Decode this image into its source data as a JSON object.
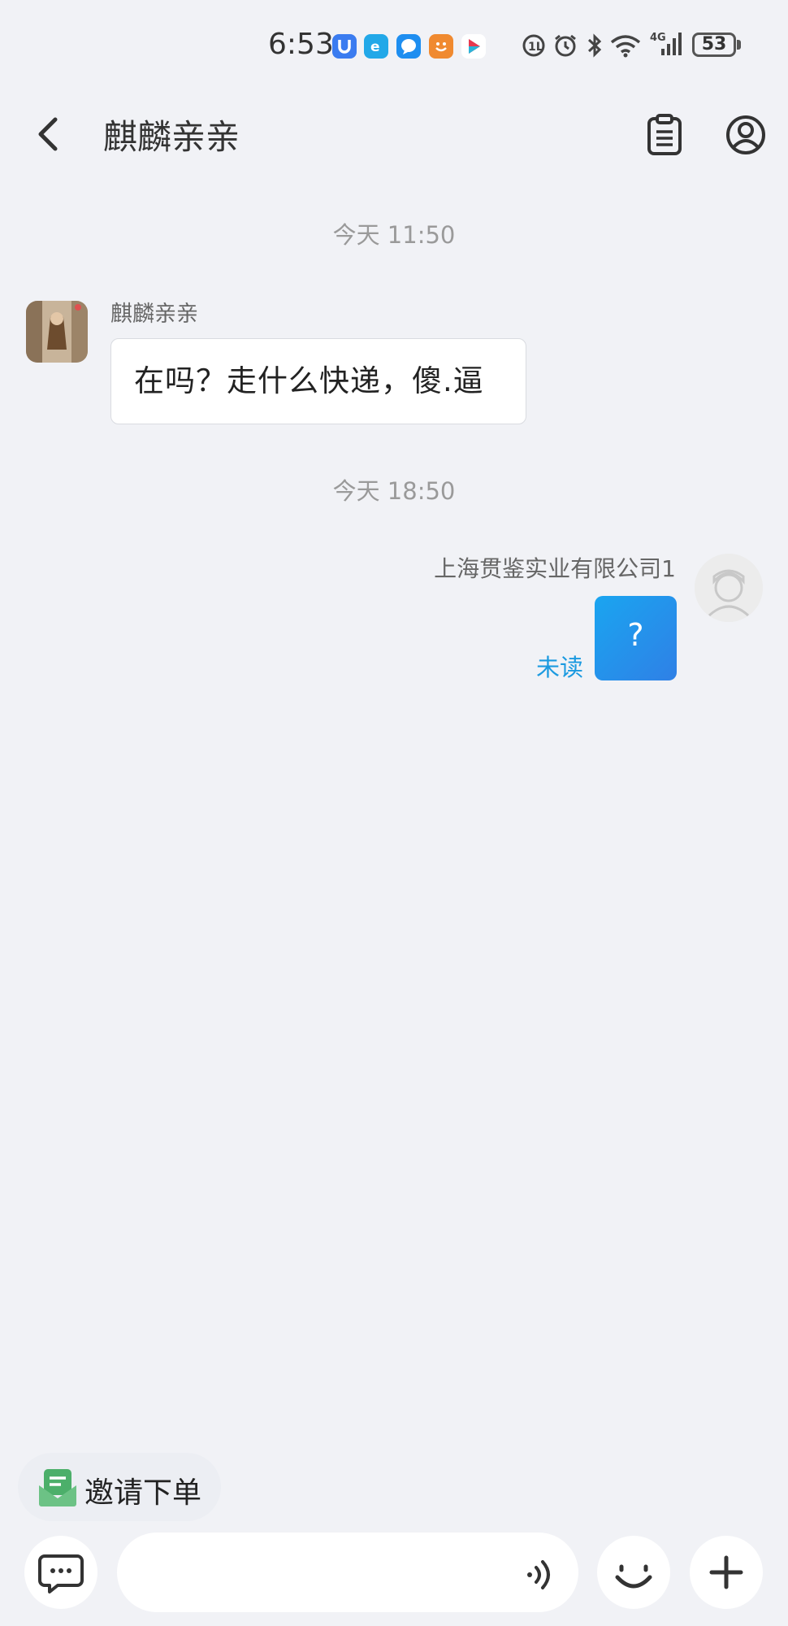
{
  "status_bar": {
    "time": "6:53",
    "battery": "53",
    "network": "4G",
    "notification_apps": [
      {
        "icon": "app-u-icon",
        "color": "#3b7cf0"
      },
      {
        "icon": "app-e-icon",
        "color": "#22a8e8"
      },
      {
        "icon": "app-chat-icon",
        "color": "#1e8ef0"
      },
      {
        "icon": "app-smile-icon",
        "color": "#f08a30"
      },
      {
        "icon": "app-play-icon",
        "color": "#e8384f"
      }
    ]
  },
  "header": {
    "title": "麒麟亲亲",
    "back_icon": "chevron-left-icon",
    "order_icon": "clipboard-icon",
    "profile_icon": "user-circle-icon"
  },
  "messages": [
    {
      "type": "time",
      "text": "今天  11:50"
    },
    {
      "type": "incoming",
      "sender": "麒麟亲亲",
      "text": "在吗？走什么快递，傻.逼"
    },
    {
      "type": "time",
      "text": "今天  18:50"
    },
    {
      "type": "outgoing",
      "sender": "上海贯鉴实业有限公司1",
      "text": "?",
      "status": "未读"
    }
  ],
  "invite": {
    "label": "邀请下单",
    "icon": "invite-envelope-icon",
    "color": "#4caf6a"
  },
  "input_bar": {
    "placeholder": "",
    "chat_icon": "chat-bubble-icon",
    "voice_icon": "voice-icon",
    "emoji_icon": "smile-icon",
    "plus_icon": "plus-icon"
  },
  "colors": {
    "background": "#f1f2f6",
    "accent": "#1b9ae0",
    "bubble_out": "#2f8ee8"
  }
}
